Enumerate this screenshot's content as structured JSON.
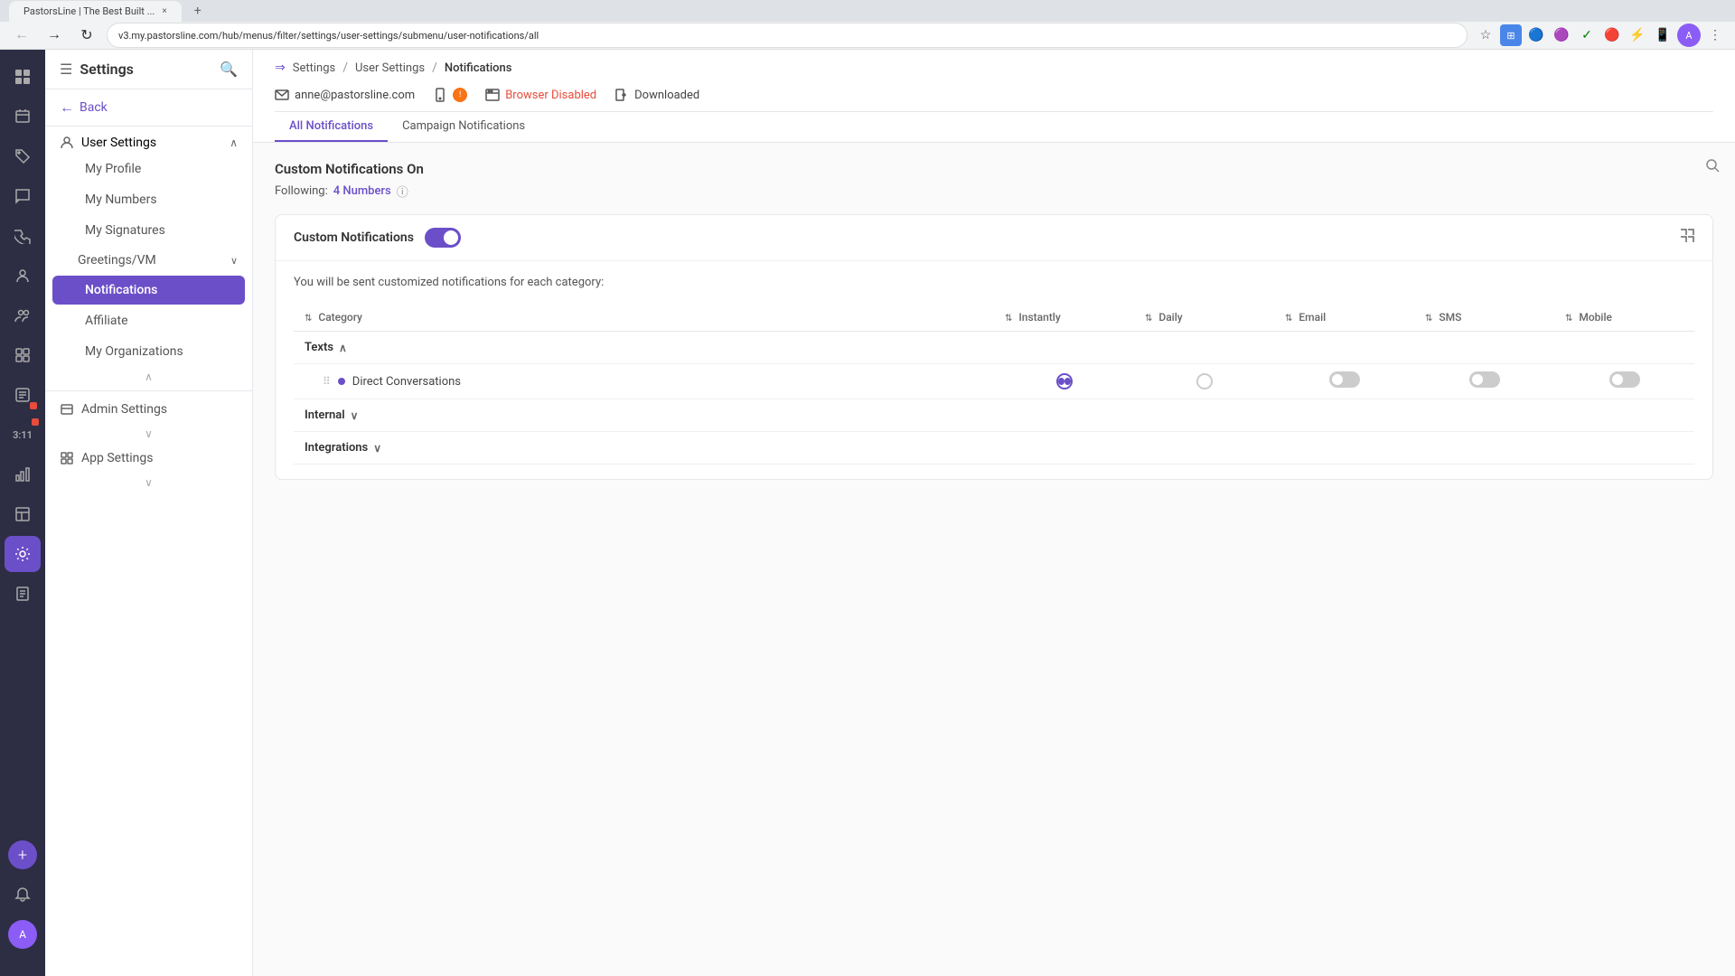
{
  "browser": {
    "tab_title": "PastorsLine | The Best Built ...",
    "address": "v3.my.pastorsline.com/hub/menus/filter/settings/user-settings/submenu/user-notifications/all"
  },
  "sidebar": {
    "title": "Settings",
    "back_label": "Back",
    "user_settings_label": "User Settings",
    "nav_items": [
      {
        "id": "my-profile",
        "label": "My Profile"
      },
      {
        "id": "my-numbers",
        "label": "My Numbers"
      },
      {
        "id": "my-signatures",
        "label": "My Signatures"
      },
      {
        "id": "greetings-vm",
        "label": "Greetings/VM"
      },
      {
        "id": "notifications",
        "label": "Notifications"
      },
      {
        "id": "affiliate",
        "label": "Affiliate"
      },
      {
        "id": "my-organizations",
        "label": "My Organizations"
      }
    ],
    "admin_settings_label": "Admin Settings",
    "app_settings_label": "App Settings"
  },
  "breadcrumb": {
    "settings": "Settings",
    "user_settings": "User Settings",
    "notifications": "Notifications"
  },
  "notification_channels": {
    "email": "anne@pastorsline.com",
    "mobile_label": "",
    "browser_label": "Browser Disabled",
    "downloaded_label": "Downloaded"
  },
  "tabs": {
    "all_notifications": "All Notifications",
    "campaign_notifications": "Campaign Notifications"
  },
  "content": {
    "section_title": "Custom Notifications On",
    "following_label": "Following:",
    "following_count": "4 Numbers",
    "card_title": "Custom Notifications",
    "card_description": "You will be sent customized notifications for each category:",
    "toggle_enabled": true,
    "columns": {
      "category": "Category",
      "instantly": "Instantly",
      "daily": "Daily",
      "email": "Email",
      "sms": "SMS",
      "mobile": "Mobile"
    },
    "sections": [
      {
        "id": "texts",
        "label": "Texts",
        "expanded": true,
        "items": [
          {
            "label": "Direct Conversations",
            "instantly_selected": true,
            "daily_selected": false,
            "email_on": false,
            "sms_on": false,
            "mobile_on": false
          }
        ]
      },
      {
        "id": "internal",
        "label": "Internal",
        "expanded": false,
        "items": []
      },
      {
        "id": "integrations",
        "label": "Integrations",
        "expanded": false,
        "items": []
      }
    ]
  },
  "icon_nav": {
    "items": [
      {
        "id": "grid",
        "icon": "⊞",
        "active": false
      },
      {
        "id": "campaigns",
        "label": "Campaigns",
        "active": false
      },
      {
        "id": "tags",
        "label": "Tags",
        "active": false
      },
      {
        "id": "chat",
        "label": "Chat",
        "active": false
      },
      {
        "id": "phone",
        "label": "Phone",
        "active": false
      },
      {
        "id": "contacts",
        "label": "Contacts",
        "active": false
      },
      {
        "id": "web-widgets",
        "label": "Web Widgets",
        "active": false
      },
      {
        "id": "shortcode",
        "label": "Shortcode Keywords",
        "active": false
      },
      {
        "id": "analytics",
        "label": "Analytics",
        "active": false
      },
      {
        "id": "templates",
        "label": "Templates",
        "active": false
      },
      {
        "id": "settings",
        "label": "Settings",
        "active": true
      },
      {
        "id": "legacy",
        "label": "Legacy",
        "active": false
      }
    ],
    "timer": "3:11",
    "add_label": "+"
  }
}
